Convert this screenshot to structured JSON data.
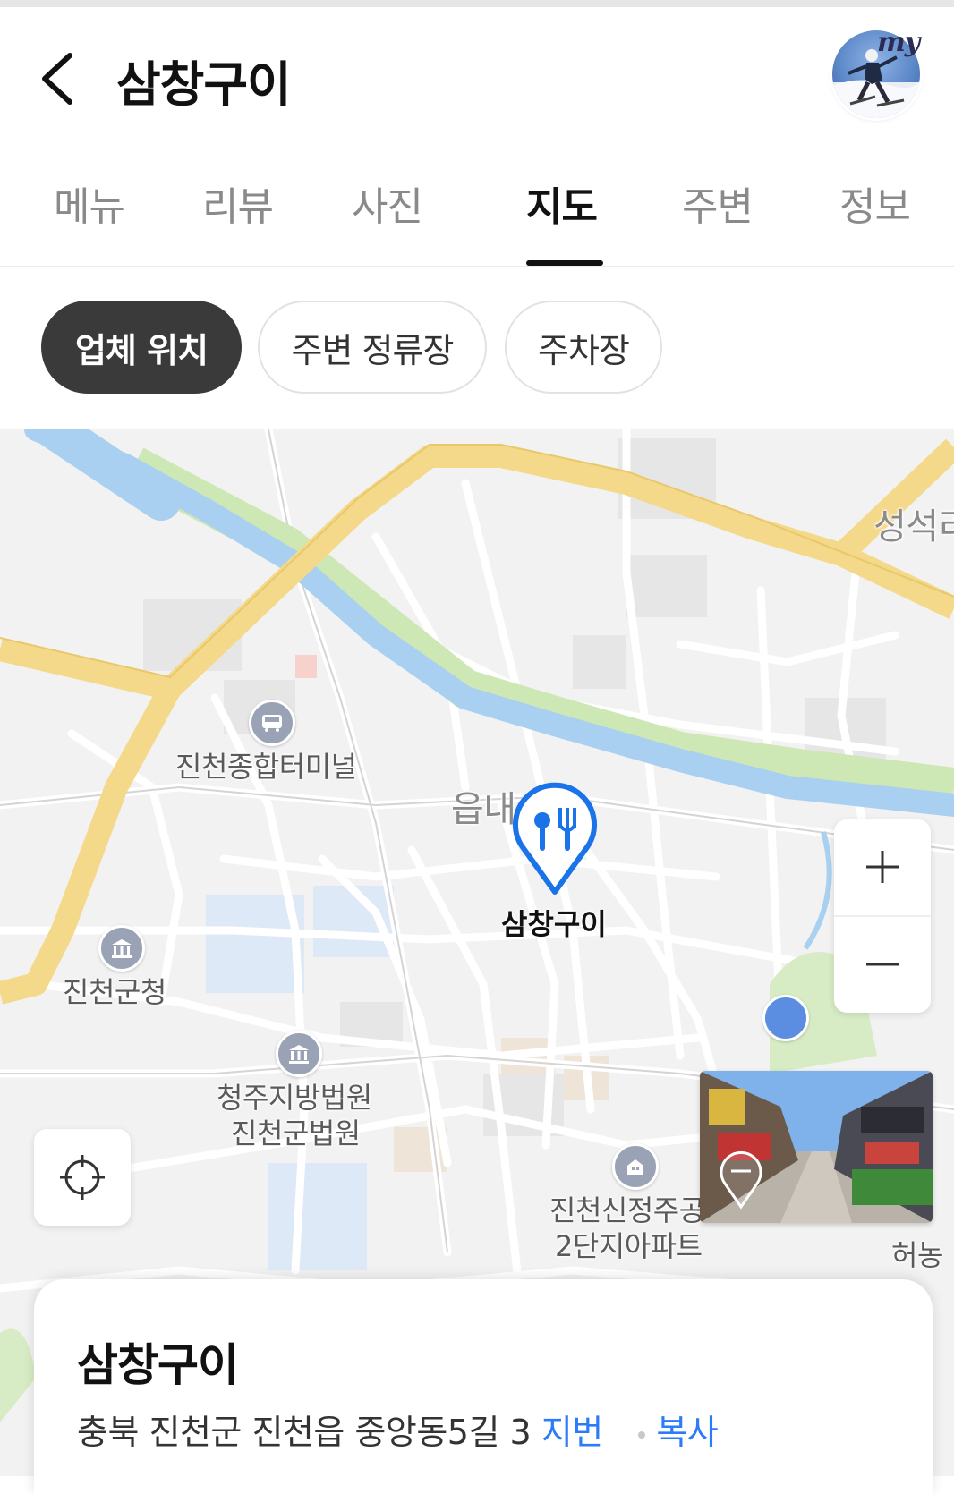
{
  "header": {
    "title": "삼창구이",
    "back_icon": "chevron-left-icon",
    "profile_badge": "my"
  },
  "tabs": [
    {
      "label": "메뉴",
      "active": false
    },
    {
      "label": "리뷰",
      "active": false
    },
    {
      "label": "사진",
      "active": false
    },
    {
      "label": "지도",
      "active": true
    },
    {
      "label": "주변",
      "active": false
    },
    {
      "label": "정보",
      "active": false
    }
  ],
  "chips": [
    {
      "label": "업체 위치",
      "active": true
    },
    {
      "label": "주변 정류장",
      "active": false
    },
    {
      "label": "주차장",
      "active": false
    }
  ],
  "map": {
    "labels": {
      "terminal": "진천종합터미널",
      "town": "읍내",
      "county_office": "진천군청",
      "court_line1": "청주지방법원",
      "court_line2": "진천군법원",
      "apartment_line1": "진천신정주공",
      "apartment_line2": "2단지아파트",
      "area_top_right": "성석리",
      "area_bottom_right": "허농",
      "marker": "삼창구이"
    },
    "zoom_in_icon": "plus-icon",
    "zoom_out_icon": "minus-icon",
    "locate_icon": "crosshair-icon",
    "colors": {
      "accent": "#1a73e8",
      "road_major": "#f5d98a",
      "river": "#a9d0f0",
      "park": "#cfe8b8"
    }
  },
  "place_card": {
    "name": "삼창구이",
    "address": "충북 진천군 진천읍 중앙동5길 3",
    "lot_link": "지번",
    "copy_link": "복사"
  }
}
